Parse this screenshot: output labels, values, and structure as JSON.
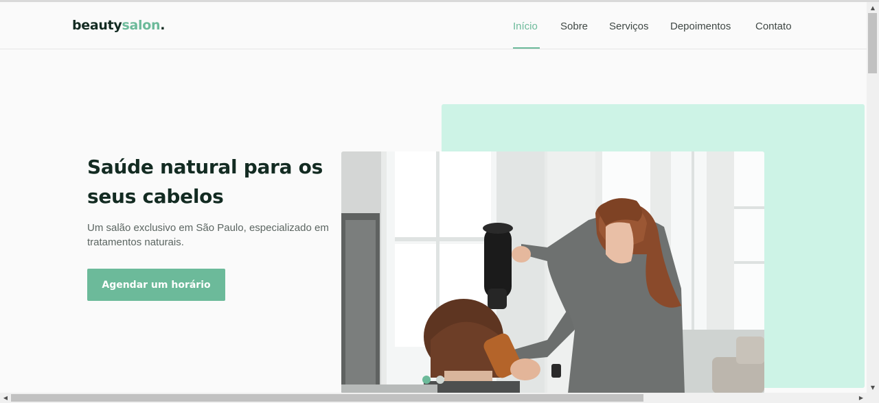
{
  "header": {
    "logo_main": "beauty",
    "logo_accent": "salon",
    "logo_dot": "."
  },
  "nav": {
    "items": [
      {
        "label": "Início",
        "active": true
      },
      {
        "label": "Sobre",
        "active": false
      },
      {
        "label": "Serviços",
        "active": false
      },
      {
        "label": "Depoimentos",
        "active": false
      },
      {
        "label": "Contato",
        "active": false
      }
    ]
  },
  "hero": {
    "title": "Saúde natural para os seus cabelos",
    "subtitle": "Um salão exclusivo em São Paulo, especializado em tratamentos naturais.",
    "cta_label": "Agendar um horário"
  },
  "colors": {
    "accent": "#6cba9a",
    "mint": "#cdf3e6",
    "heading": "#132b22"
  },
  "icons": {
    "scroll_up": "▲",
    "scroll_down": "▼",
    "scroll_left": "◀",
    "scroll_right": "▶"
  }
}
